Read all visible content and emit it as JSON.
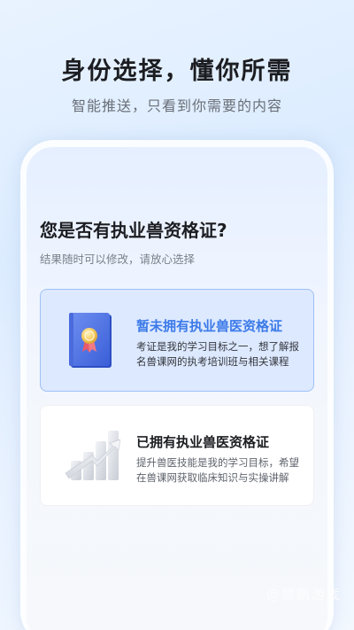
{
  "header": {
    "title": "身份选择，懂你所需",
    "subtitle": "智能推送，只看到你需要的内容"
  },
  "screen": {
    "question": "您是否有执业兽资格证?",
    "hint": "结果随时可以修改，请放心选择",
    "options": [
      {
        "title": "暂未拥有执业兽医资格证",
        "description": "考证是我的学习目标之一，想了解报名兽课网的执考培训班与相关课程",
        "icon": "certificate-book-icon",
        "selected": true
      },
      {
        "title": "已拥有执业兽医资格证",
        "description": "提升兽医技能是我的学习目标，希望在兽课网获取临床知识与实操讲解",
        "icon": "growth-bars-icon",
        "selected": false
      }
    ]
  },
  "watermark": "@慧鹏游戏",
  "colors": {
    "accent": "#3b7ae8",
    "selected_bg": "#dde9ff",
    "selected_border": "#9ec0f5"
  }
}
